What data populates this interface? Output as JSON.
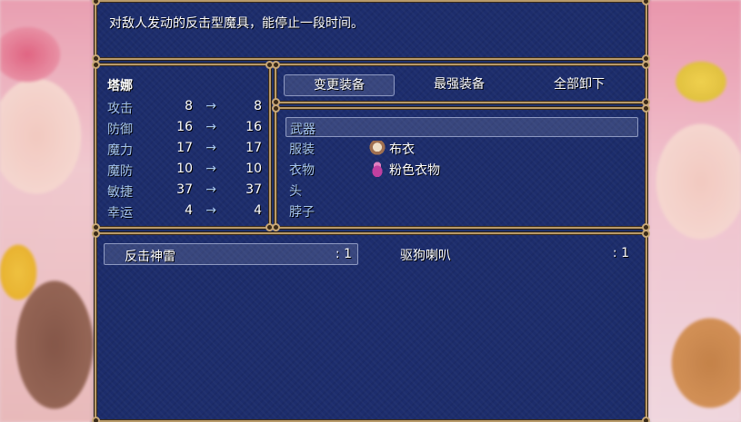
{
  "help": {
    "text": "对敌人发动的反击型魔具，能停止一段时间。"
  },
  "status": {
    "actor_name": "塔娜",
    "stats": [
      {
        "label": "攻击",
        "old": "8",
        "arrow": "→",
        "new": "8"
      },
      {
        "label": "防御",
        "old": "16",
        "arrow": "→",
        "new": "16"
      },
      {
        "label": "魔力",
        "old": "17",
        "arrow": "→",
        "new": "17"
      },
      {
        "label": "魔防",
        "old": "10",
        "arrow": "→",
        "new": "10"
      },
      {
        "label": "敏捷",
        "old": "37",
        "arrow": "→",
        "new": "37"
      },
      {
        "label": "幸运",
        "old": "4",
        "arrow": "→",
        "new": "4"
      }
    ]
  },
  "commands": [
    {
      "label": "变更装备",
      "selected": true
    },
    {
      "label": "最强装备",
      "selected": false
    },
    {
      "label": "全部卸下",
      "selected": false
    }
  ],
  "slots": [
    {
      "label": "武器",
      "item": "",
      "icon": ""
    },
    {
      "label": "服装",
      "item": "布衣",
      "icon": "clothes-icon"
    },
    {
      "label": "衣物",
      "item": "粉色衣物",
      "icon": "dress-icon"
    },
    {
      "label": "头",
      "item": "",
      "icon": ""
    },
    {
      "label": "脖子",
      "item": "",
      "icon": ""
    }
  ],
  "items": [
    {
      "name": "反击神雷",
      "count": ": 1",
      "selected": true
    },
    {
      "name": "驱狗喇叭",
      "count": ": 1",
      "selected": false
    }
  ],
  "colors": {
    "window_bg": "#1c2c6c",
    "frame": "#b89a6a",
    "system_text": "#a8c8f0"
  }
}
